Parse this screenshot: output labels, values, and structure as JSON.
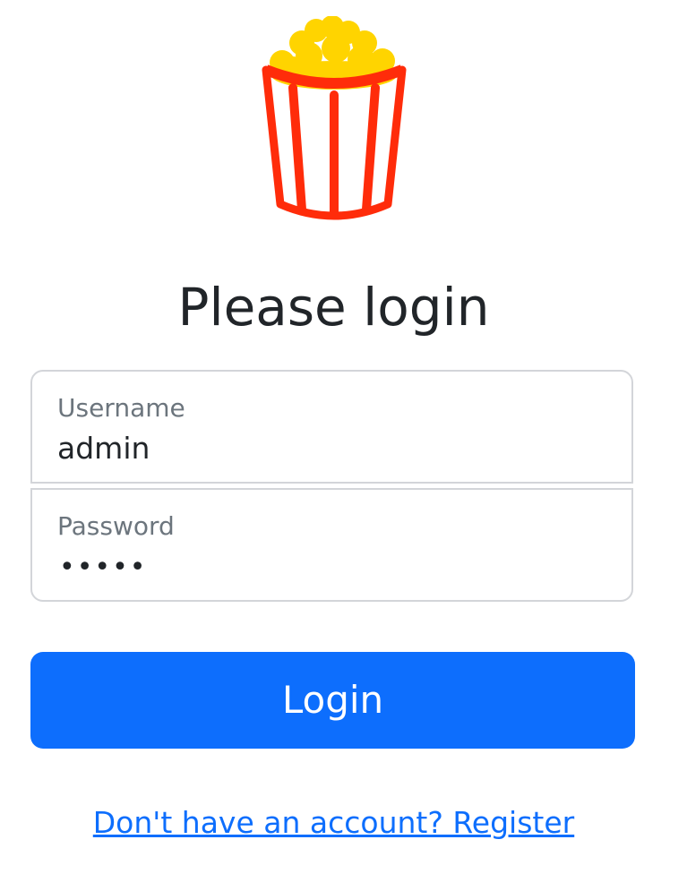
{
  "logo": {
    "icon": "popcorn-bucket-icon",
    "colors": {
      "bucket": "#ff2c0a",
      "popcorn": "#ffd400"
    }
  },
  "title": "Please login",
  "form": {
    "username": {
      "label": "Username",
      "value": "admin"
    },
    "password": {
      "label": "Password",
      "value_masked": "•••••"
    },
    "login_button": "Login",
    "register_link": "Don't have an account? Register"
  },
  "colors": {
    "primary": "#0d6efd",
    "text": "#212529",
    "muted": "#6c757d",
    "border": "#d3d5d9"
  }
}
